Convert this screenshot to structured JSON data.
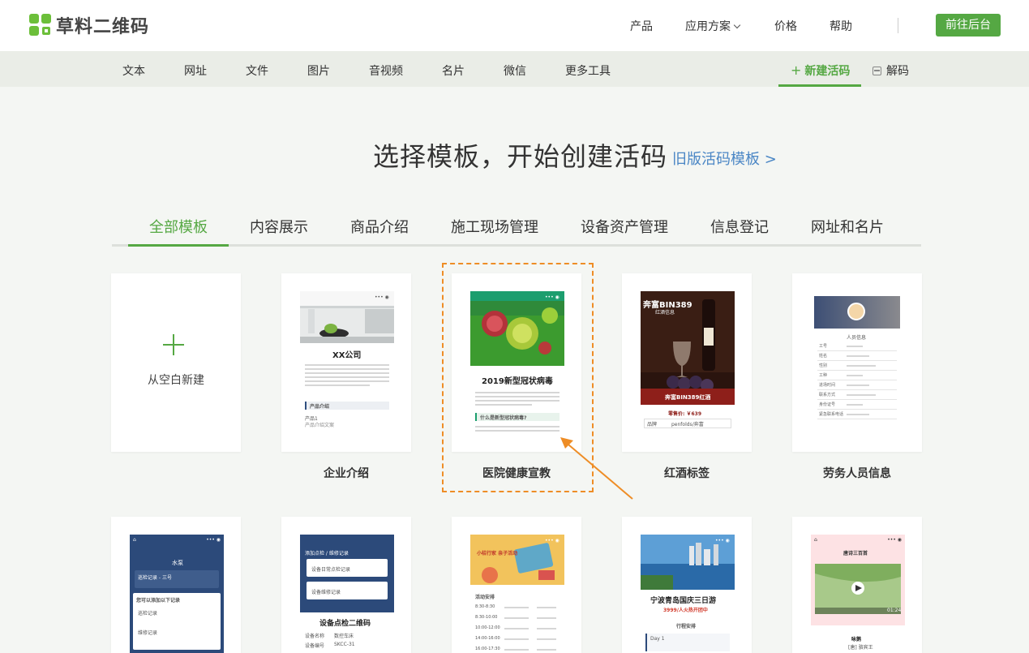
{
  "brand": {
    "name": "草料二维码"
  },
  "topnav": {
    "products": "产品",
    "solutions": "应用方案",
    "pricing": "价格",
    "help": "帮助",
    "backend_button": "前往后台"
  },
  "subnav": {
    "items": [
      "文本",
      "网址",
      "文件",
      "图片",
      "音视频",
      "名片",
      "微信",
      "更多工具"
    ],
    "new_code": "新建活码",
    "decode": "解码"
  },
  "page": {
    "heading": "选择模板，开始创建活码",
    "old_templates_link": "旧版活码模板 >"
  },
  "tabs": [
    "全部模板",
    "内容展示",
    "商品介绍",
    "施工现场管理",
    "设备资产管理",
    "信息登记",
    "网址和名片"
  ],
  "cards": {
    "blank": "从空白新建",
    "labels": [
      "企业介绍",
      "医院健康宣教",
      "红酒标签",
      "劳务人员信息"
    ]
  },
  "thumbs": {
    "company": {
      "title": "XX公司",
      "section": "产品介绍",
      "product": "产品1",
      "product_desc": "产品介绍文案"
    },
    "hospital": {
      "title": "2019新型冠状病毒",
      "question": "什么是新型冠状病毒?"
    },
    "wine": {
      "title": "奔富BIN389",
      "subtitle": "红酒信息",
      "banner": "奔富BIN389红酒",
      "price": "零售价: ￥639",
      "row1_k": "品牌",
      "row1_v": "penfolds/奔富"
    },
    "worker": {
      "title": "人员信息",
      "rows": [
        "工号",
        "姓名",
        "性别",
        "工种",
        "进场时间",
        "联系方式",
        "身份证号",
        "紧急联系电话"
      ]
    },
    "water": {
      "title": "水泵",
      "l1": "巡检记录 - 三号",
      "l2": "您可以添加以下记录",
      "l3": "巡检记录",
      "l4": "维修记录"
    },
    "inspect": {
      "top": "添加点检 / 维修记录",
      "b1": "设备日常点检记录",
      "b2": "设备维修记录",
      "title": "设备点检二维码",
      "c1": "设备名称",
      "c2": "数控车床",
      "c3": "设备编号",
      "c4": "SKCC-31"
    },
    "trip": {
      "banner": "小桔行家 亲子活动",
      "head": "活动安排",
      "times": [
        "8:30-8:30",
        "8:30-10:00",
        "10:00-12:00",
        "14:00-16:00",
        "16:00-17:30"
      ]
    },
    "tour": {
      "title": "宁波青岛国庆三日游",
      "price": "3999/人火热开团中",
      "sec": "行程安排",
      "day": "Day 1"
    },
    "poem": {
      "title": "唐诗三百首",
      "time": "01:24",
      "poem": "咏鹅",
      "author": "[唐] 骆宾王"
    }
  }
}
